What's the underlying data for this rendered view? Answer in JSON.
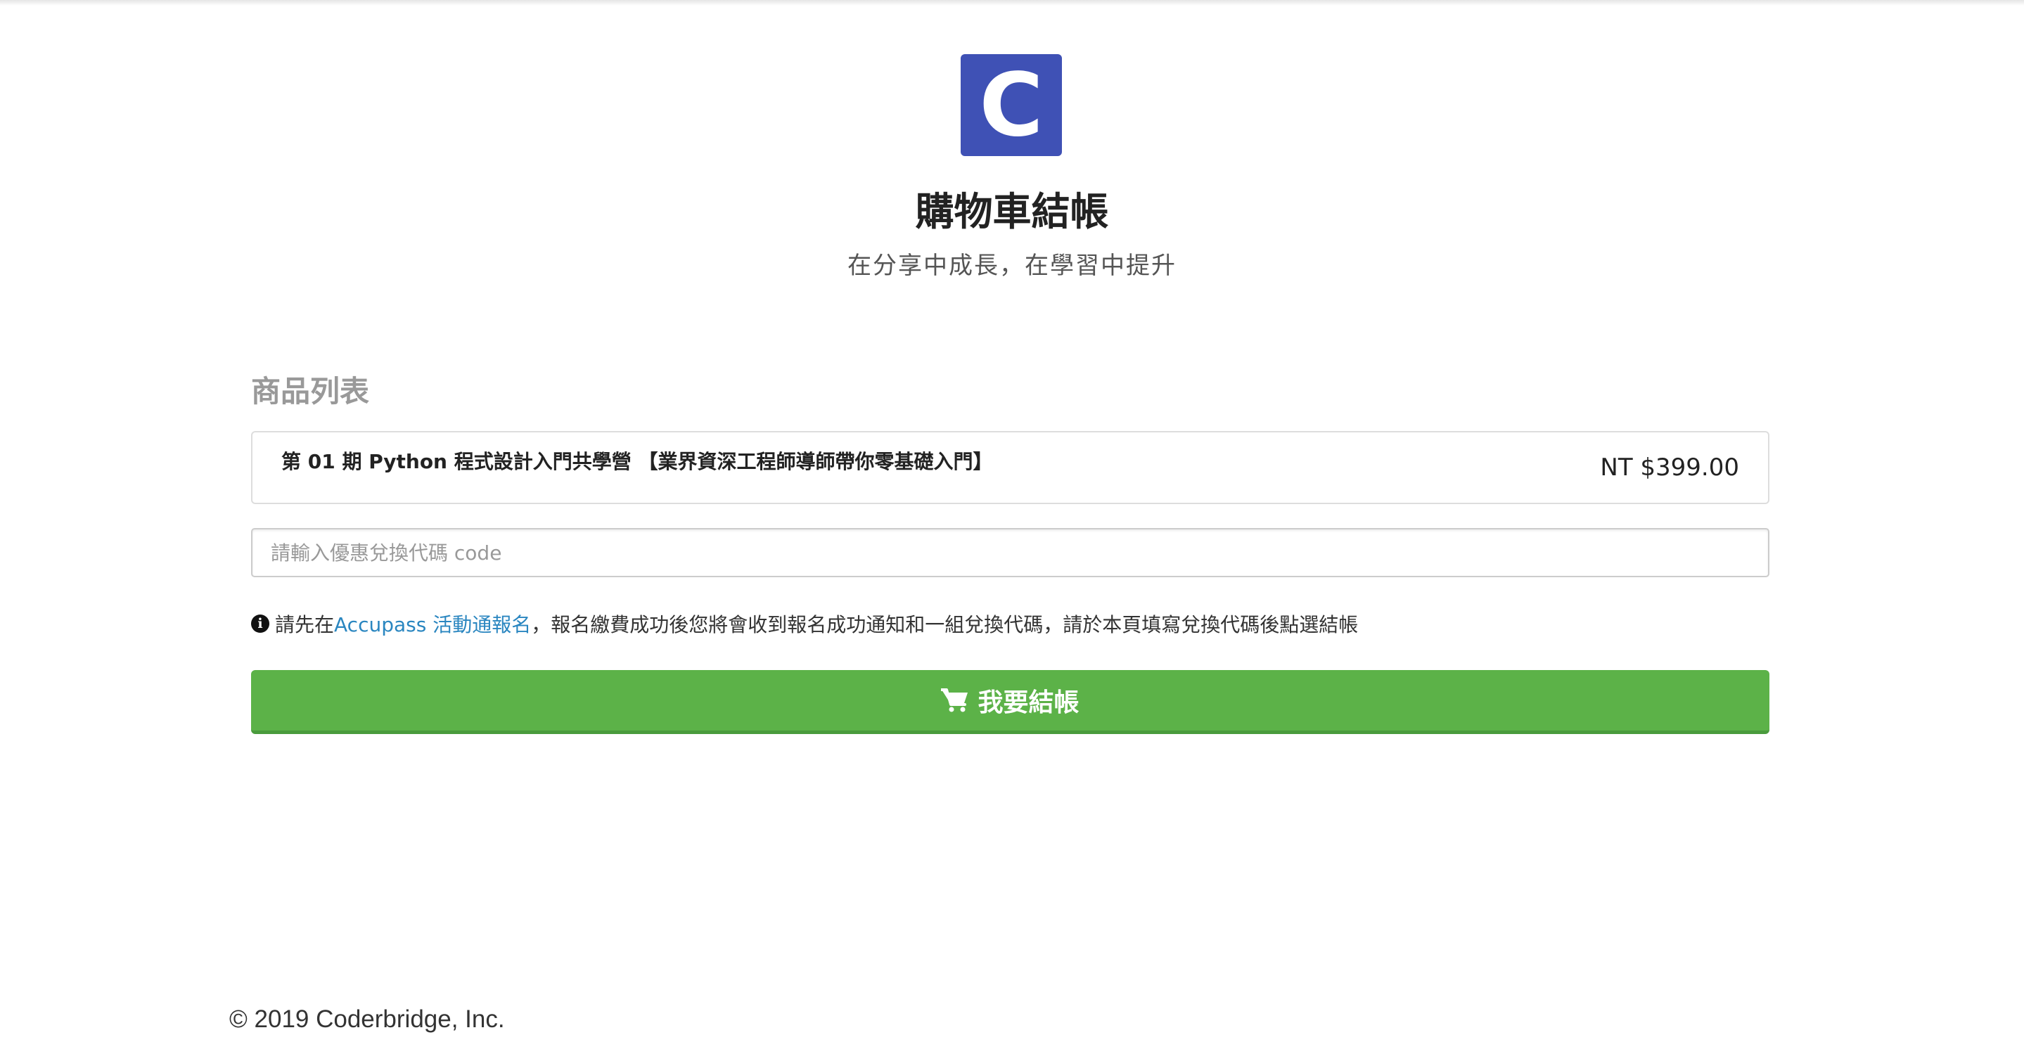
{
  "colors": {
    "logo_bg": "#3F51B5",
    "button_bg": "#5CB248",
    "link": "#2A86C0"
  },
  "logo": {
    "letter": "C"
  },
  "header": {
    "title": "購物車結帳",
    "subtitle": "在分享中成長，在學習中提升"
  },
  "cart": {
    "section_title": "商品列表",
    "items": [
      {
        "name": "第 01 期 Python 程式設計入門共學營 【業界資深工程師導師帶你零基礎入門】",
        "price": "NT $399.00"
      }
    ]
  },
  "coupon": {
    "placeholder": "請輸入優惠兌換代碼 code",
    "value": ""
  },
  "notice": {
    "icon": "info-circle-icon",
    "prefix": "請先在 ",
    "link_text": "Accupass 活動通報名",
    "suffix": "，報名繳費成功後您將會收到報名成功通知和一組兌換代碼，請於本頁填寫兌換代碼後點選結帳"
  },
  "checkout": {
    "icon": "shopping-cart-icon",
    "label": "我要結帳"
  },
  "footer": {
    "copyright": "© 2019 Coderbridge, Inc."
  }
}
